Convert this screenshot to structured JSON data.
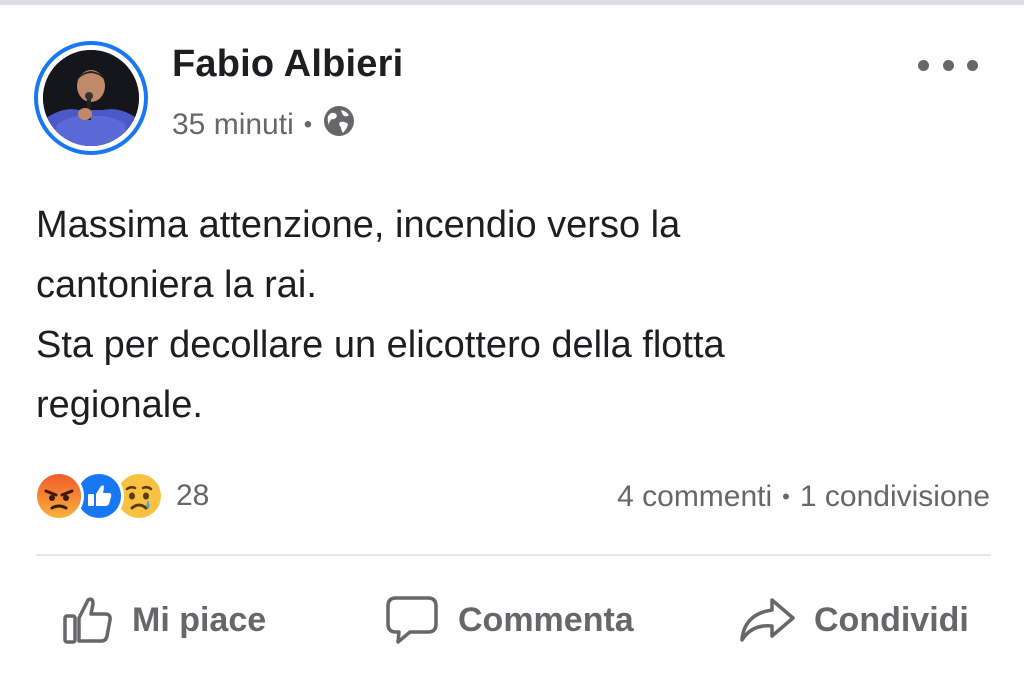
{
  "post": {
    "author": "Fabio Albieri",
    "time": "35 minuti",
    "separator": "•",
    "privacy_icon": "globe-icon",
    "body_lines": [
      "Massima attenzione, incendio verso la",
      "cantoniera la rai.",
      "Sta per decollare un elicottero della flotta",
      "regionale."
    ]
  },
  "reactions": {
    "icons": [
      "angry-reaction-icon",
      "like-reaction-icon",
      "sad-reaction-icon"
    ],
    "count": "28"
  },
  "stats": {
    "comments": "4 commenti",
    "separator": "•",
    "shares": "1 condivisione"
  },
  "actions": {
    "like": "Mi piace",
    "comment": "Commenta",
    "share": "Condividi"
  },
  "colors": {
    "accent": "#1877f2",
    "secondary_text": "#65676b",
    "primary_text": "#1c1e21",
    "angry": "#f0642a",
    "sad": "#f7c241"
  }
}
